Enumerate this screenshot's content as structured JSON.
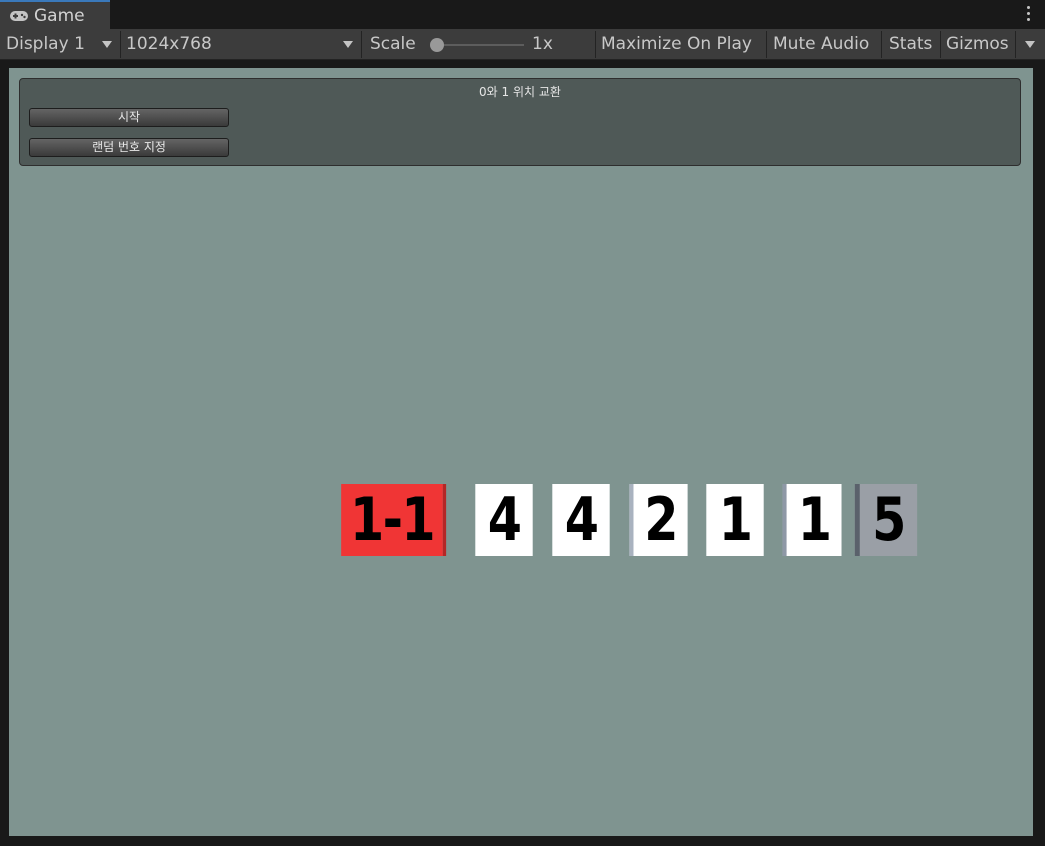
{
  "window": {
    "tab_title": "Game",
    "tab_icon": "gamepad-icon"
  },
  "toolbar": {
    "display": "Display 1",
    "resolution": "1024x768",
    "scale_label": "Scale",
    "scale_value": "1x",
    "maximize": "Maximize On Play",
    "mute": "Mute Audio",
    "stats": "Stats",
    "gizmos": "Gizmos"
  },
  "gui": {
    "title": "0와 1 위치 교환",
    "start_button": "시작",
    "random_button": "랜덤 번호 지정"
  },
  "cubes": [
    {
      "label": "1-1",
      "color": "#f03535"
    },
    {
      "label": "4",
      "color": "#ffffff"
    },
    {
      "label": "4",
      "color": "#ffffff"
    },
    {
      "label": "2",
      "color": "#ffffff"
    },
    {
      "label": "1",
      "color": "#ffffff"
    },
    {
      "label": "1",
      "color": "#ffffff"
    },
    {
      "label": "5",
      "color": "#9a9fa6"
    }
  ],
  "colors": {
    "game_background": "#7f9490",
    "editor_dark": "#191919",
    "toolbar": "#3c3c3c",
    "tab_accent": "#3a79bb"
  }
}
